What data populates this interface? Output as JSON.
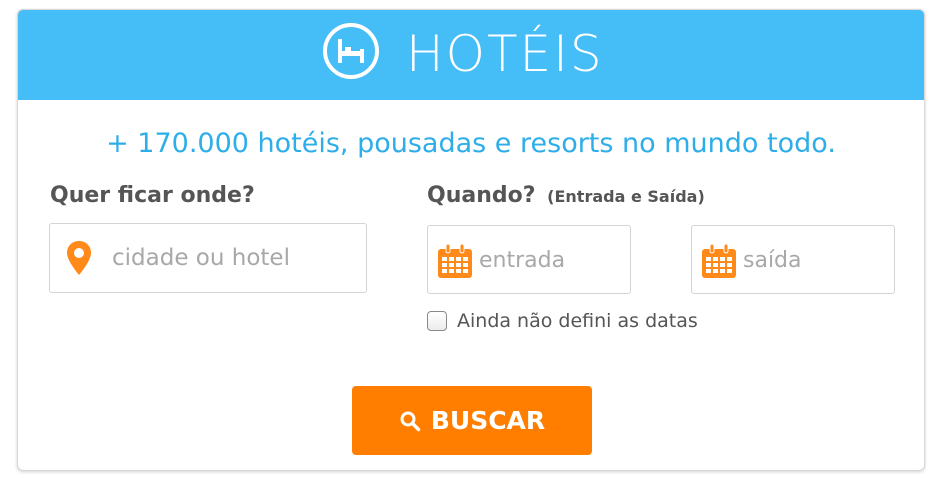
{
  "header": {
    "title": "HOTÉIS",
    "logo_icon": "bed-icon",
    "background_color": "#45bdf7"
  },
  "tagline": "+ 170.000 hotéis, pousadas e resorts no mundo todo.",
  "where": {
    "label": "Quer ficar onde?",
    "icon": "map-pin-icon",
    "placeholder": "cidade ou hotel",
    "value": ""
  },
  "when": {
    "label": "Quando?",
    "sublabel": "(Entrada e Saída)",
    "checkin": {
      "icon": "calendar-icon",
      "placeholder": "entrada",
      "value": ""
    },
    "checkout": {
      "icon": "calendar-icon",
      "placeholder": "saída",
      "value": ""
    },
    "undecided_checkbox": {
      "label": "Ainda não defini as datas",
      "checked": false
    }
  },
  "search_button": {
    "label": "BUSCAR",
    "icon": "search-icon",
    "color": "#ff7e00"
  },
  "colors": {
    "accent_blue": "#2eaee9",
    "accent_orange": "#ff7e00",
    "label_gray": "#555555"
  }
}
